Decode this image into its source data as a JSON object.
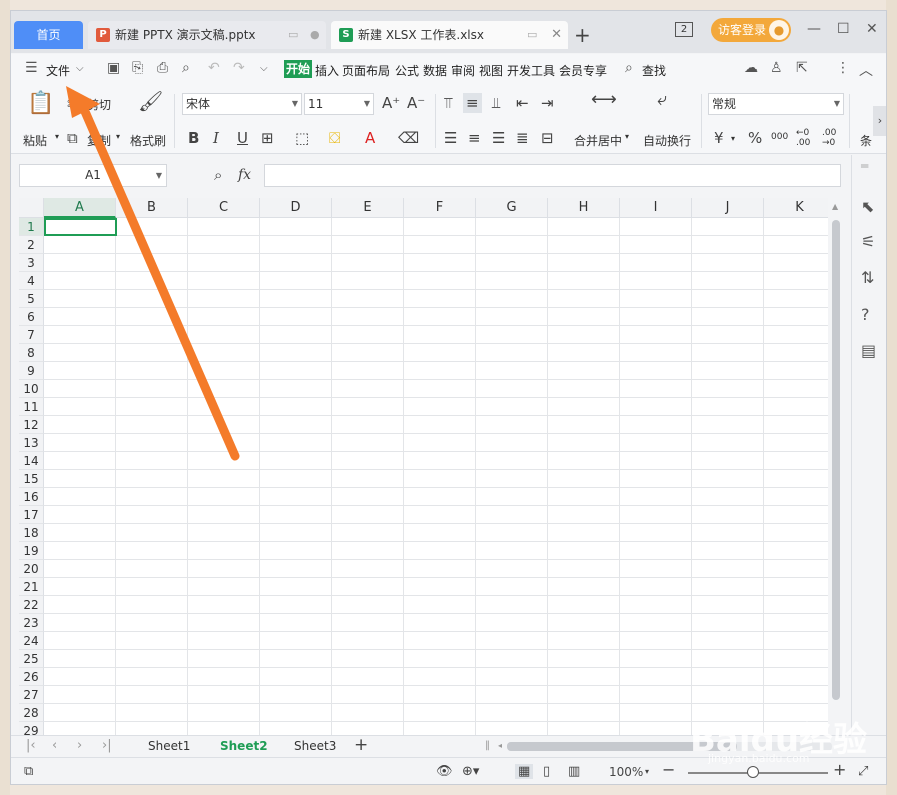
{
  "tabs": {
    "home": "首页",
    "tab1": {
      "icon": "P",
      "icon_color": "#e15a3c",
      "label": "新建 PPTX 演示文稿.pptx"
    },
    "tab2": {
      "icon": "S",
      "icon_color": "#1f9d55",
      "label": "新建 XLSX 工作表.xlsx"
    },
    "badge": "2",
    "login": "访客登录"
  },
  "menu": {
    "file": "文件",
    "items": [
      "开始",
      "插入",
      "页面布局",
      "公式",
      "数据",
      "审阅",
      "视图",
      "开发工具",
      "会员专享"
    ],
    "active": "开始",
    "search": "查找"
  },
  "ribbon": {
    "paste": "粘贴",
    "cut": "剪切",
    "copy": "复制",
    "format_painter": "格式刷",
    "font": "宋体",
    "size": "11",
    "merge": "合并居中",
    "wrap": "自动换行",
    "number_format": "常规",
    "cond": "条",
    "currency": "¥",
    "percent": "%",
    "thousands": "000",
    "inc_decimal": "←0 .00",
    "dec_decimal": ".00 →0"
  },
  "formula": {
    "cell": "A1",
    "fx": "fx"
  },
  "grid": {
    "columns": [
      "A",
      "B",
      "C",
      "D",
      "E",
      "F",
      "G",
      "H",
      "I",
      "J",
      "K"
    ],
    "rows": [
      "1",
      "2",
      "3",
      "4",
      "5",
      "6",
      "7",
      "8",
      "9",
      "10",
      "11",
      "12",
      "13",
      "14",
      "15",
      "16",
      "17",
      "18",
      "19",
      "20",
      "21",
      "22",
      "23",
      "24",
      "25",
      "26",
      "27",
      "28",
      "29"
    ],
    "selected_cell": "A1"
  },
  "sheets": [
    "Sheet1",
    "Sheet2",
    "Sheet3"
  ],
  "active_sheet": "Sheet2",
  "status": {
    "zoom": "100%"
  },
  "watermark": {
    "main": "Baidu经验",
    "sub": "jingyan.baidu.com"
  },
  "colors": {
    "accent": "#1f9d55",
    "home_tab": "#4f8ef7",
    "login": "#f3a83b",
    "arrow": "#f47b2a"
  }
}
